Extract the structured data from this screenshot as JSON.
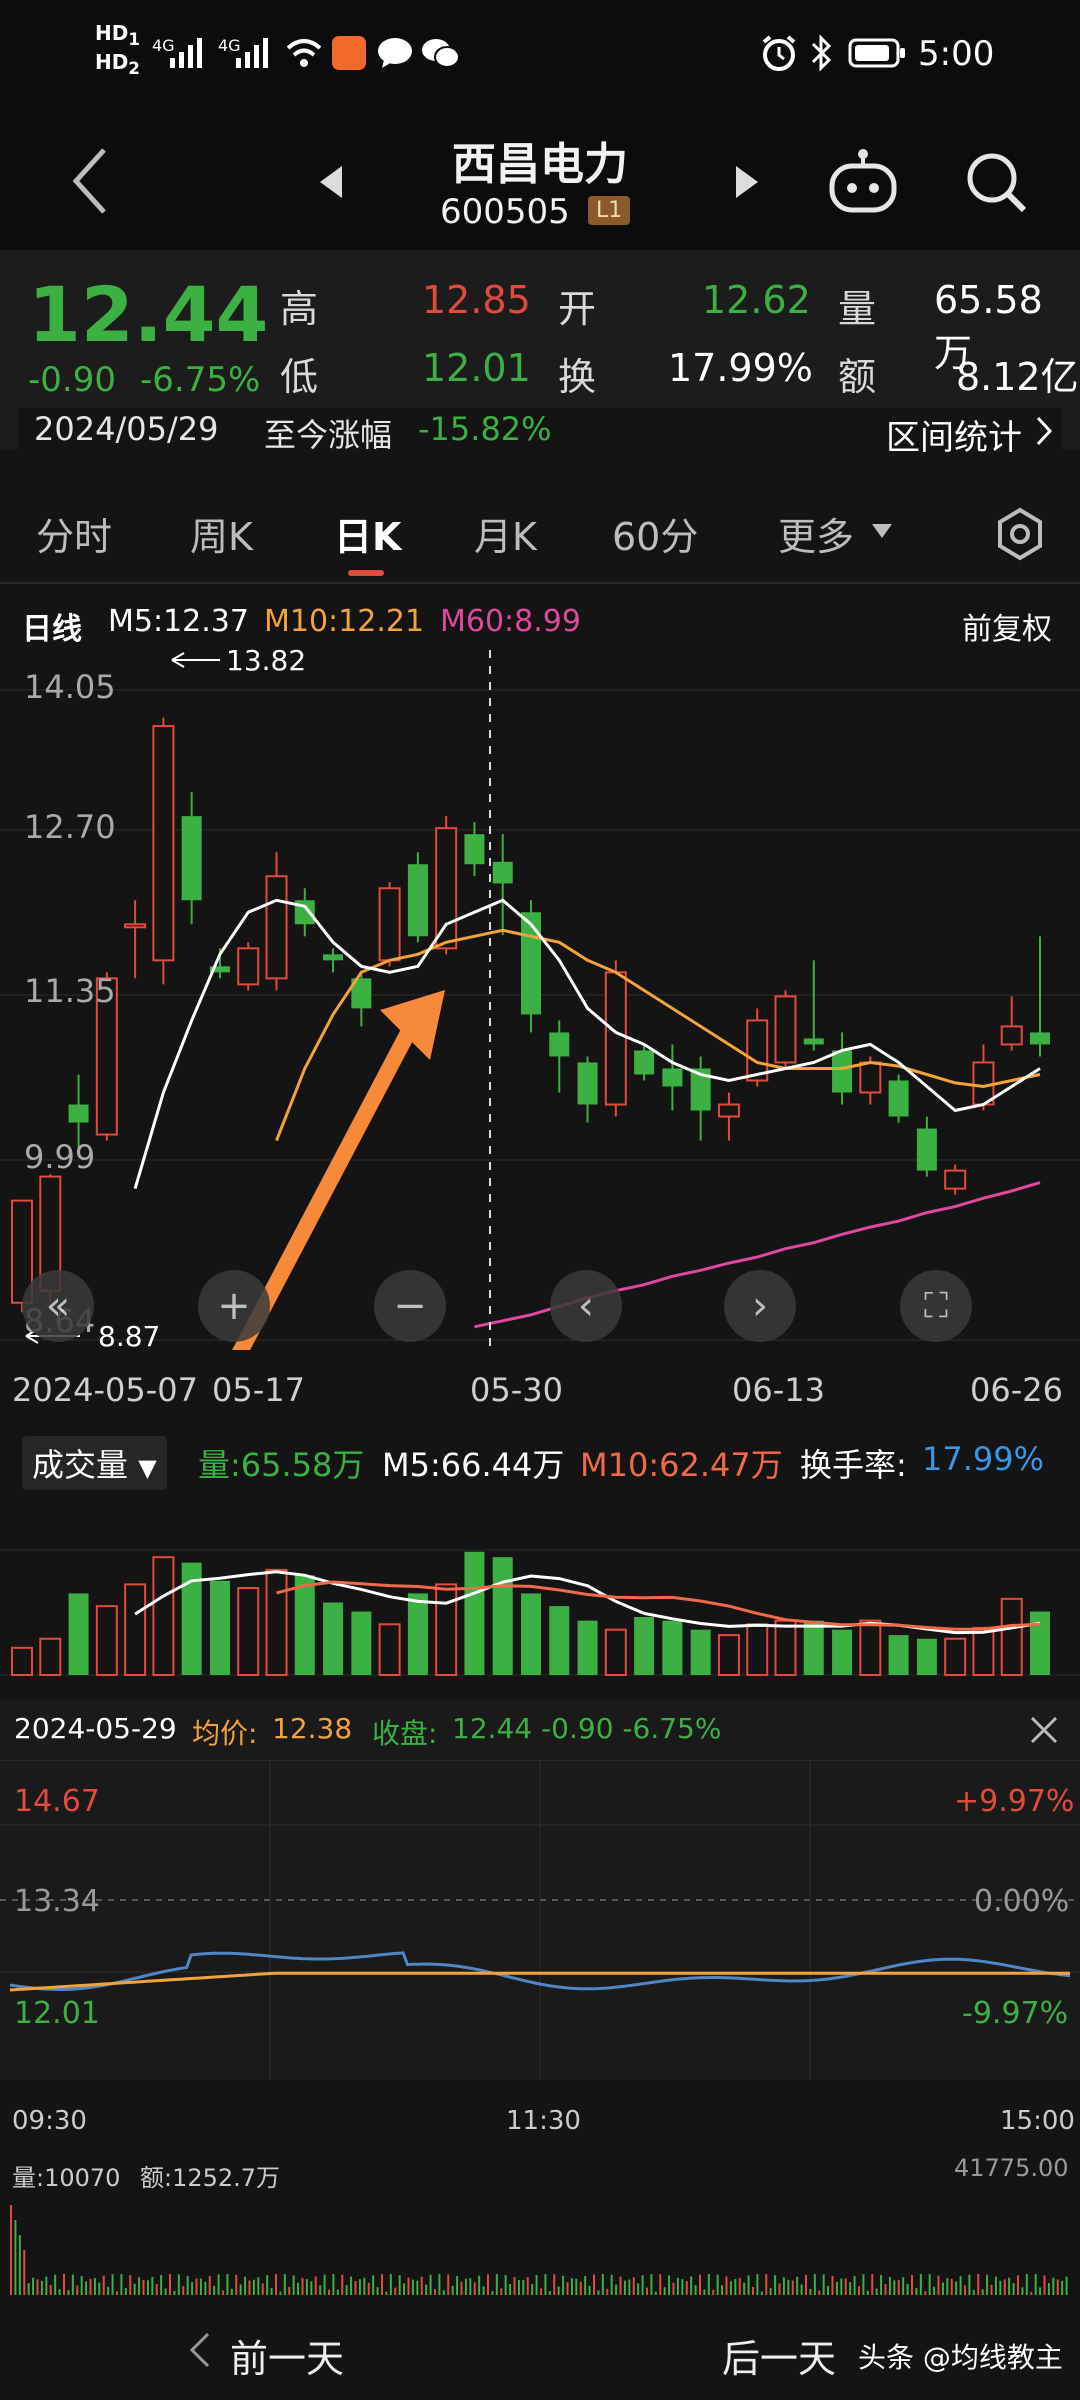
{
  "status": {
    "hd1": "HD",
    "hd1_sub": "1",
    "hd2": "HD",
    "hd2_sub": "2",
    "sig1": "4G",
    "sig2": "4G",
    "time": "5:00"
  },
  "nav": {
    "title": "西昌电力",
    "code": "600505",
    "badge": "L1"
  },
  "quote": {
    "price": "12.44",
    "change": "-0.90",
    "pct": "-6.75%",
    "high_label": "高",
    "high": "12.85",
    "open_label": "开",
    "open": "12.62",
    "vol_label": "量",
    "vol": "65.58万",
    "low_label": "低",
    "low": "12.01",
    "turn_label": "换",
    "turn": "17.99%",
    "amt_label": "额",
    "amt": "8.12亿",
    "date": "2024/05/29",
    "since_label": "至今涨幅",
    "since": "-15.82%",
    "range_stats": "区间统计"
  },
  "tabs": [
    {
      "label": "分时"
    },
    {
      "label": "周K"
    },
    {
      "label": "日K"
    },
    {
      "label": "月K"
    },
    {
      "label": "60分"
    },
    {
      "label": "更多"
    }
  ],
  "ma": {
    "line_label": "日线",
    "m5": "M5:12.37",
    "m10": "M10:12.21",
    "m60": "M60:8.99",
    "adjust": "前复权"
  },
  "kchart": {
    "y_labels": [
      "14.05",
      "12.70",
      "11.35",
      "9.99",
      "8.64"
    ],
    "high_note": "13.82",
    "low_note": "8.87",
    "x_labels": [
      "2024-05-07",
      "05-17",
      "05-30",
      "06-13",
      "06-26"
    ]
  },
  "volume": {
    "label": "成交量",
    "vol": "量:65.58万",
    "m5": "M5:66.44万",
    "m10": "M10:62.47万",
    "turn_label": "换手率:",
    "turn": "17.99%"
  },
  "intraday": {
    "date": "2024-05-29",
    "avg_label": "均价:",
    "avg": "12.38",
    "close_label": "收盘:",
    "close": "12.44 -0.90 -6.75%",
    "top": "14.67",
    "mid": "13.34",
    "bottom": "12.01",
    "top_pct": "+9.97%",
    "mid_pct": "0.00%",
    "bottom_pct": "-9.97%",
    "t_start": "09:30",
    "t_mid": "11:30",
    "t_end": "15:00",
    "vol_info": "量:10070",
    "amt_info": "额:1252.7万",
    "vol_max": "41775.00"
  },
  "bottom": {
    "prev": "前一天",
    "next": "后一天",
    "watermark": "头条 @均线教主"
  },
  "colors": {
    "up": "#e24a3b",
    "down": "#3cb043",
    "m5": "#ffffff",
    "m10": "#f3a33b",
    "m60": "#e0489d",
    "arrow": "#f6893a"
  },
  "chart_data": {
    "type": "candlestick",
    "ylim": [
      8.64,
      14.05
    ],
    "candles": [
      [
        8.95,
        9.8,
        9.0,
        8.87
      ],
      [
        9.05,
        10.0,
        10.02,
        8.95
      ],
      [
        10.6,
        10.45,
        10.85,
        10.2
      ],
      [
        10.35,
        11.65,
        11.7,
        10.3
      ],
      [
        12.1,
        12.1,
        12.3,
        11.65
      ],
      [
        11.8,
        13.75,
        13.82,
        11.6
      ],
      [
        13.0,
        12.3,
        13.2,
        12.1
      ],
      [
        11.75,
        11.7,
        11.9,
        11.65
      ],
      [
        11.6,
        11.9,
        11.95,
        11.55
      ],
      [
        11.65,
        12.5,
        12.7,
        11.55
      ],
      [
        12.3,
        12.1,
        12.4,
        12.0
      ],
      [
        11.85,
        11.8,
        11.9,
        11.7
      ],
      [
        11.65,
        11.4,
        11.7,
        11.25
      ],
      [
        11.8,
        12.4,
        12.45,
        11.75
      ],
      [
        12.6,
        12.0,
        12.7,
        11.95
      ],
      [
        11.9,
        12.9,
        13.0,
        11.85
      ],
      [
        12.85,
        12.6,
        12.95,
        12.5
      ],
      [
        12.62,
        12.44,
        12.85,
        12.01
      ],
      [
        12.2,
        11.35,
        12.3,
        11.2
      ],
      [
        11.2,
        11.0,
        11.3,
        10.7
      ],
      [
        10.95,
        10.6,
        11.0,
        10.45
      ],
      [
        10.6,
        11.7,
        11.8,
        10.5
      ],
      [
        11.05,
        10.85,
        11.1,
        10.8
      ],
      [
        10.9,
        10.75,
        11.1,
        10.55
      ],
      [
        10.9,
        10.55,
        11.0,
        10.3
      ],
      [
        10.5,
        10.6,
        10.7,
        10.3
      ],
      [
        10.8,
        11.3,
        11.4,
        10.75
      ],
      [
        10.95,
        11.5,
        11.55,
        10.9
      ],
      [
        11.15,
        11.1,
        11.8,
        11.05
      ],
      [
        11.05,
        10.7,
        11.2,
        10.6
      ],
      [
        10.7,
        10.95,
        11.0,
        10.6
      ],
      [
        10.8,
        10.5,
        10.85,
        10.45
      ],
      [
        10.4,
        10.05,
        10.5,
        10.0
      ],
      [
        9.9,
        10.05,
        10.1,
        9.85
      ],
      [
        10.6,
        10.95,
        11.1,
        10.55
      ],
      [
        11.1,
        11.25,
        11.5,
        11.05
      ],
      [
        11.2,
        11.1,
        12.0,
        11.0
      ]
    ],
    "ma5": [
      null,
      null,
      null,
      null,
      9.9,
      10.7,
      11.3,
      11.85,
      12.2,
      12.3,
      12.25,
      11.95,
      11.75,
      11.7,
      11.75,
      12.1,
      12.2,
      12.3,
      12.1,
      11.8,
      11.4,
      11.2,
      11.1,
      10.95,
      10.85,
      10.8,
      10.85,
      10.9,
      10.95,
      11.05,
      11.1,
      10.95,
      10.75,
      10.55,
      10.6,
      10.75,
      10.9
    ],
    "ma10": [
      null,
      null,
      null,
      null,
      null,
      null,
      null,
      null,
      null,
      10.3,
      10.9,
      11.35,
      11.7,
      11.8,
      11.85,
      11.95,
      12.0,
      12.05,
      12.0,
      11.95,
      11.8,
      11.7,
      11.55,
      11.4,
      11.25,
      11.1,
      10.95,
      10.9,
      10.9,
      10.9,
      10.95,
      10.92,
      10.85,
      10.78,
      10.75,
      10.8,
      10.85
    ],
    "ma60": [
      null,
      null,
      null,
      null,
      null,
      null,
      null,
      null,
      null,
      null,
      null,
      null,
      null,
      null,
      null,
      null,
      8.75,
      8.8,
      8.85,
      8.92,
      8.99,
      9.05,
      9.1,
      9.17,
      9.22,
      9.28,
      9.33,
      9.4,
      9.45,
      9.52,
      9.58,
      9.63,
      9.7,
      9.75,
      9.82,
      9.88,
      9.95
    ],
    "volumes": [
      15,
      20,
      45,
      38,
      50,
      65,
      62,
      52,
      48,
      58,
      55,
      40,
      35,
      28,
      45,
      50,
      68,
      65,
      45,
      38,
      30,
      25,
      32,
      30,
      25,
      22,
      28,
      30,
      30,
      25,
      30,
      22,
      20,
      20,
      26,
      42,
      35
    ],
    "vol_ylim": [
      0,
      80
    ]
  }
}
